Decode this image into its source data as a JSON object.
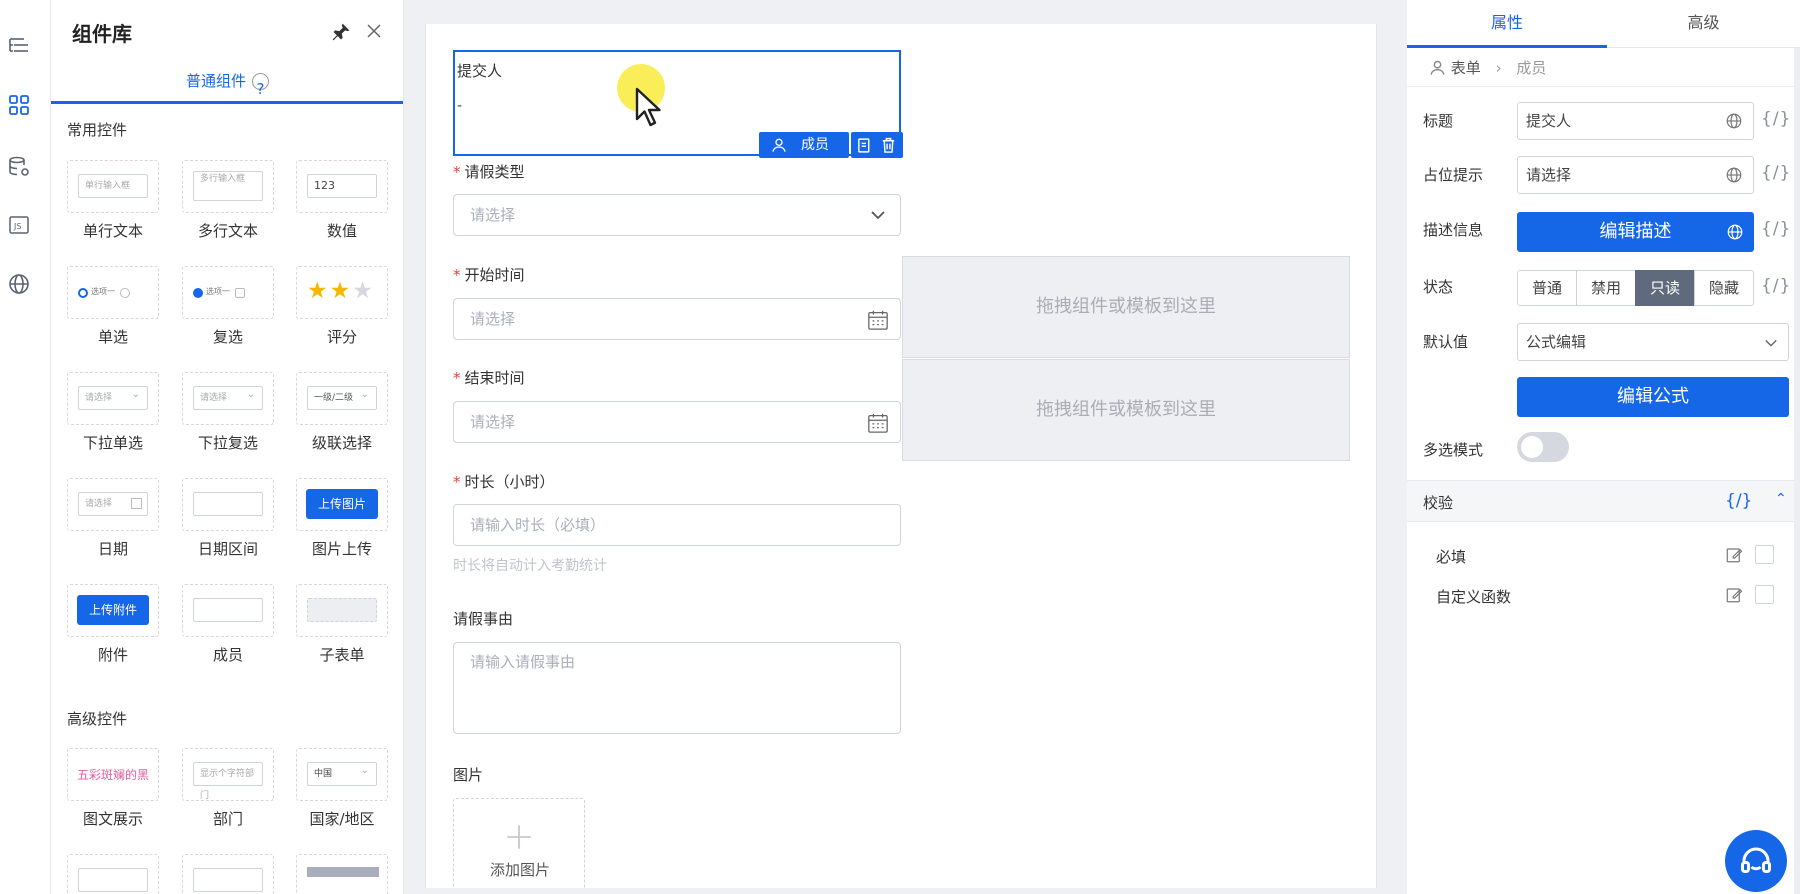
{
  "library": {
    "title": "组件库",
    "tab_label": "普通组件",
    "section_common": "常用控件",
    "section_advanced": "高级控件",
    "tiles": [
      {
        "label": "单行文本",
        "preview": "单行输入框"
      },
      {
        "label": "多行文本",
        "preview": "多行输入框"
      },
      {
        "label": "数值",
        "preview": "123"
      },
      {
        "label": "单选",
        "preview": "选项一"
      },
      {
        "label": "复选",
        "preview": "选项一"
      },
      {
        "label": "评分",
        "preview": ""
      },
      {
        "label": "下拉单选",
        "preview": "请选择"
      },
      {
        "label": "下拉复选",
        "preview": "请选择"
      },
      {
        "label": "级联选择",
        "preview": "一级/二级"
      },
      {
        "label": "日期",
        "preview": "请选择"
      },
      {
        "label": "日期区间",
        "preview": ""
      },
      {
        "label": "图片上传",
        "preview": "上传图片"
      },
      {
        "label": "附件",
        "preview": "上传附件"
      },
      {
        "label": "成员",
        "preview": ""
      },
      {
        "label": "子表单",
        "preview": ""
      },
      {
        "label": "图文展示",
        "preview": "五彩斑斓的黑"
      },
      {
        "label": "部门",
        "preview": "显示个字符部门"
      },
      {
        "label": "国家/地区",
        "preview": "中国"
      }
    ]
  },
  "form": {
    "submitter_label": "提交人",
    "submitter_value": "-",
    "member_tag": "成员",
    "leave_type_label": "请假类型",
    "leave_type_placeholder": "请选择",
    "start_label": "开始时间",
    "start_placeholder": "请选择",
    "end_label": "结束时间",
    "end_placeholder": "请选择",
    "duration_label": "时长（小时）",
    "duration_placeholder": "请输入时长（必填）",
    "duration_hint": "时长将自动计入考勤统计",
    "reason_label": "请假事由",
    "reason_placeholder": "请输入请假事由",
    "image_label": "图片",
    "add_image": "添加图片",
    "drop_text_1": "拖拽组件或模板到这里",
    "drop_text_2": "拖拽组件或模板到这里"
  },
  "props": {
    "tab_attr": "属性",
    "tab_advanced": "高级",
    "crumb_form": "表单",
    "crumb_member": "成员",
    "title_label": "标题",
    "title_value": "提交人",
    "placeholder_label": "占位提示",
    "placeholder_value": "请选择",
    "desc_label": "描述信息",
    "desc_button": "编辑描述",
    "state_label": "状态",
    "state_options": [
      "普通",
      "禁用",
      "只读",
      "隐藏"
    ],
    "state_selected": "只读",
    "default_label": "默认值",
    "default_value": "公式编辑",
    "formula_button": "编辑公式",
    "multi_label": "多选模式",
    "multi_on": false,
    "validation_title": "校验",
    "required_label": "必填",
    "custom_fn_label": "自定义函数",
    "brace": "{/}"
  },
  "colors": {
    "accent": "#1667e8",
    "selected_state": "#5f6b7d",
    "required": "#e34040"
  }
}
